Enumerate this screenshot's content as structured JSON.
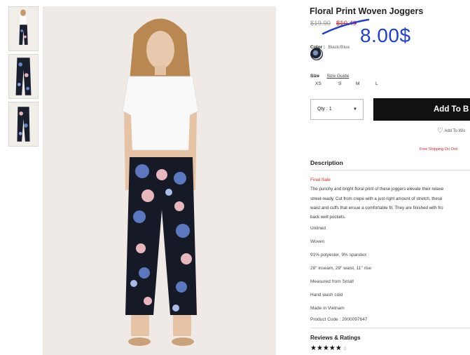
{
  "product": {
    "title": "Floral Print Woven Joggers",
    "original_price": "$19.90",
    "sale_price": "$10.49",
    "handwritten_price": "8.00$",
    "color_label": "Color :",
    "color_value": "Black/Blue",
    "size_label": "Size",
    "size_guide": "Size Guide",
    "sizes": [
      "XS",
      "S",
      "M",
      "L"
    ],
    "qty_label": "Qty : 1",
    "add_button": "Add To B",
    "wishlist": "Add To Wis",
    "free_shipping": "Free Shipping On Ord"
  },
  "description": {
    "heading": "Description",
    "final_sale": "Final Sale",
    "lines": [
      "The punchy and bright floral print of these joggers elevate their relaxe",
      "street-ready. Cut from crepe with a just-right amount of stretch, these",
      "waist and cuffs that ensue a comfortable fit. They are finished with fro",
      "back welt pockets."
    ],
    "details": [
      "Unlined",
      "Woven",
      "91% polyester, 9% spandex",
      "28\" inseam, 29\" waist, 11\" rise",
      "Measured from Small",
      "Hand wash cold",
      "Made in Vietnam",
      "Product Code : 2000097647"
    ]
  },
  "reviews": {
    "heading": "Reviews & Ratings",
    "stars": "★★★★★",
    "extra": "0"
  },
  "colors": {
    "sale_red": "#d9232e",
    "handwriting_blue": "#1f3fd6",
    "button_black": "#111111"
  },
  "icons": {
    "wishlist": "heart-icon",
    "qty_dropdown": "caret-down-icon",
    "rating": "star-icon"
  }
}
